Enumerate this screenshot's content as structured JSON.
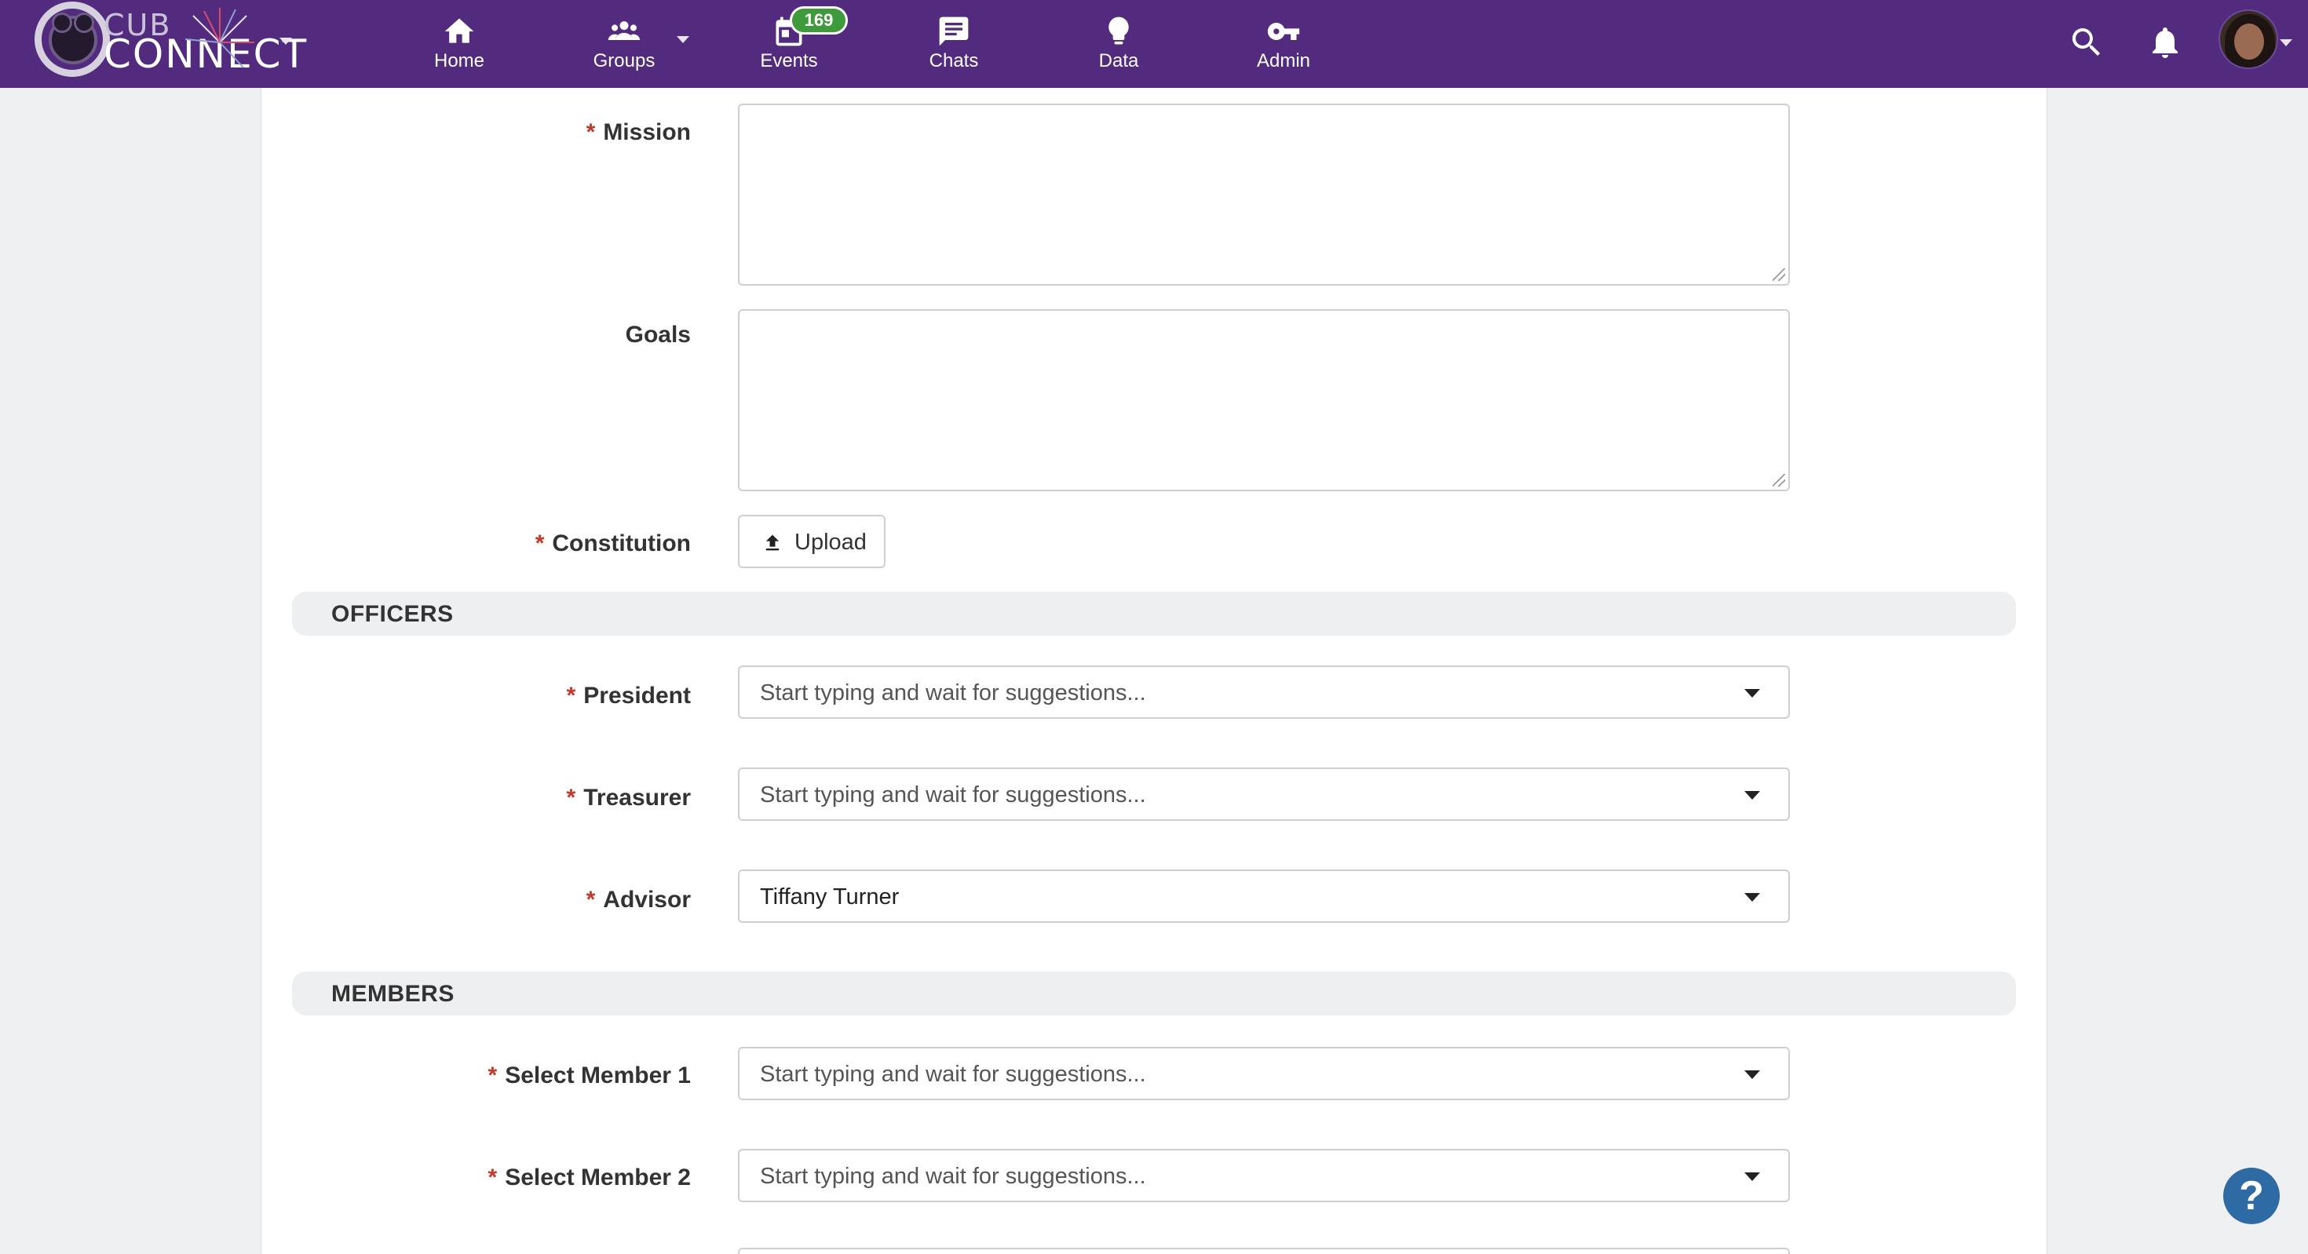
{
  "app": {
    "logo_text_top": "CUB",
    "logo_text_bottom": "CONNECT"
  },
  "nav": {
    "items": [
      {
        "label": "Home",
        "icon": "home-icon"
      },
      {
        "label": "Groups",
        "icon": "groups-icon"
      },
      {
        "label": "Events",
        "icon": "calendar-icon",
        "badge": "169"
      },
      {
        "label": "Chats",
        "icon": "chat-icon"
      },
      {
        "label": "Data",
        "icon": "lightbulb-icon"
      },
      {
        "label": "Admin",
        "icon": "key-icon"
      }
    ],
    "right_icons": [
      "search-icon",
      "bell-icon",
      "avatar"
    ]
  },
  "form": {
    "mission": {
      "label": "Mission",
      "required": "*",
      "value": ""
    },
    "goals": {
      "label": "Goals",
      "value": ""
    },
    "constitution": {
      "label": "Constitution",
      "required": "*",
      "button_label": "Upload"
    },
    "officers_section": "OFFICERS",
    "president": {
      "label": "President",
      "required": "*",
      "placeholder": "Start typing and wait for suggestions..."
    },
    "treasurer": {
      "label": "Treasurer",
      "required": "*",
      "placeholder": "Start typing and wait for suggestions..."
    },
    "advisor": {
      "label": "Advisor",
      "required": "*",
      "value": "Tiffany Turner"
    },
    "members_section": "MEMBERS",
    "member1": {
      "label": "Select Member 1",
      "required": "*",
      "placeholder": "Start typing and wait for suggestions..."
    },
    "member2": {
      "label": "Select Member 2",
      "required": "*",
      "placeholder": "Start typing and wait for suggestions..."
    }
  },
  "help": {
    "label": "?"
  },
  "colors": {
    "nav_bg": "#522b7e",
    "badge_bg": "#3f9a3c",
    "required": "#c0392b",
    "help_bg": "#2e6aa3"
  }
}
